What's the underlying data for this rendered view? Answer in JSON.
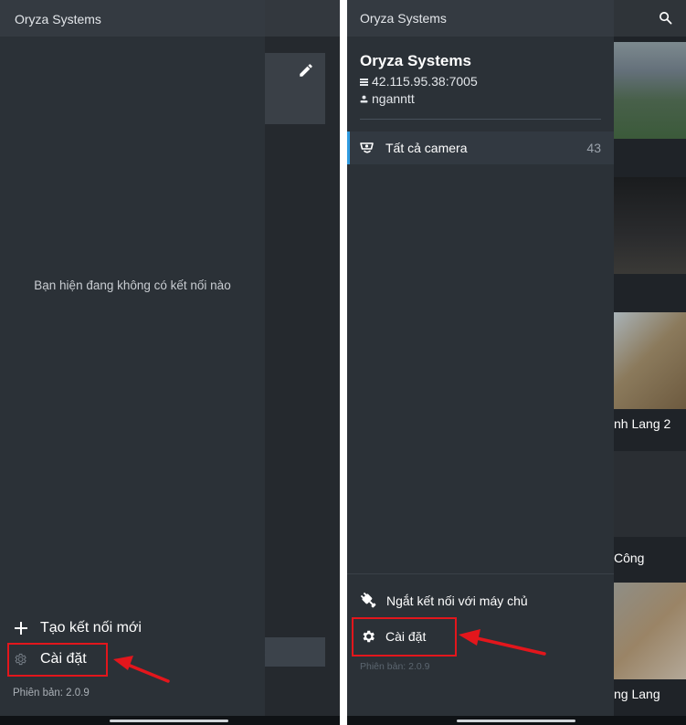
{
  "left_screen": {
    "brand": "Oryza Systems",
    "empty_message": "Bạn hiện đang không có kết nối nào",
    "new_connection_label": "Tạo kết nối mới",
    "settings_label": "Cài đặt",
    "version": "Phiên bản: 2.0.9",
    "background_bar_glyph": "‹"
  },
  "right_screen": {
    "brand": "Oryza Systems",
    "server_name": "Oryza Systems",
    "server_address": "42.115.95.38:7005",
    "username": "nganntt",
    "all_cameras_label": "Tất cả camera",
    "all_cameras_count": "43",
    "disconnect_label": "Ngắt kết nối với máy chủ",
    "settings_label": "Cài đặt",
    "version": "Phiên bản: 2.0.9",
    "camera_labels": [
      "nh Lang 2",
      "Công",
      "ng Lang"
    ],
    "icons": [
      "search-icon",
      "server-icon",
      "user-icon",
      "camera-icon",
      "plug-icon",
      "gear-icon"
    ]
  },
  "annotation": {
    "highlight_color": "#e3161c",
    "accent_color": "#2f9be0"
  }
}
